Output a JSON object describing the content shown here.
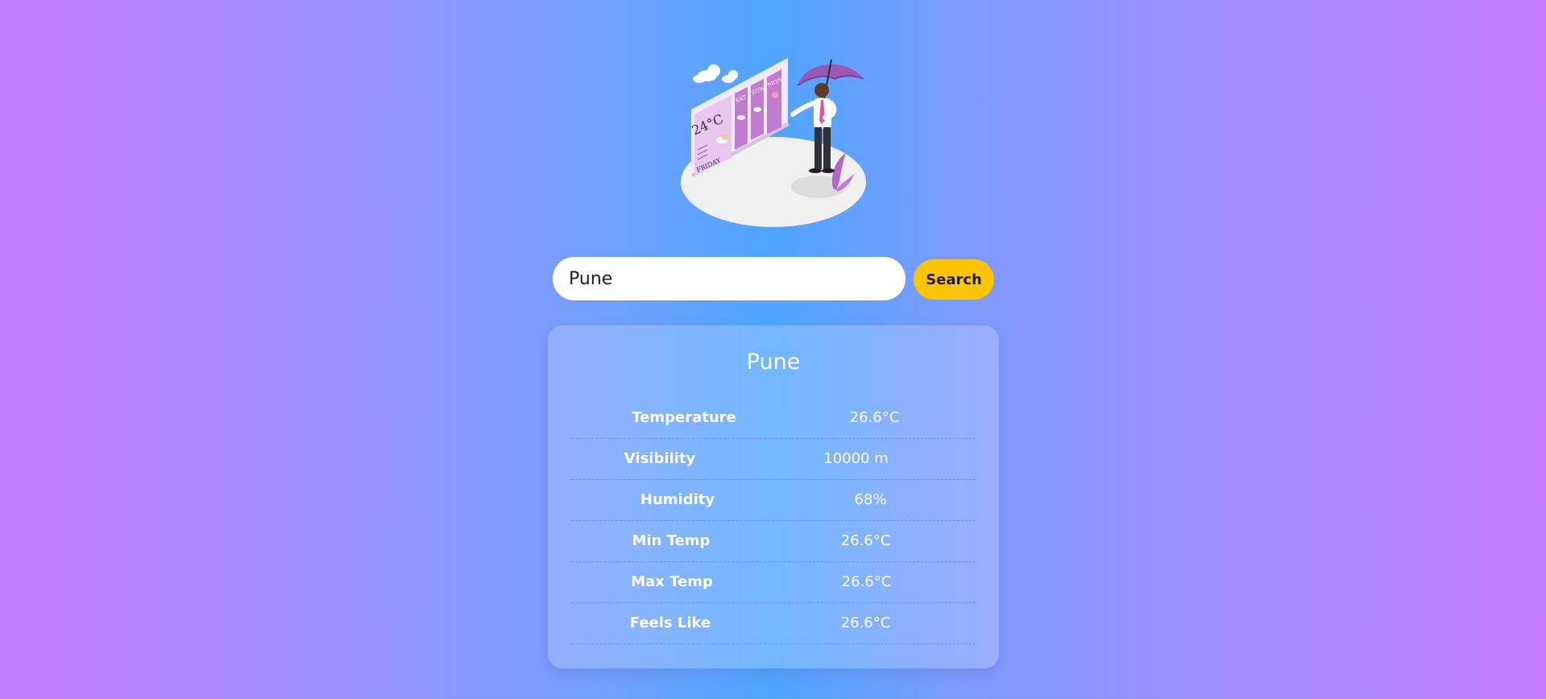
{
  "search": {
    "value": "Pune",
    "button_label": "Search"
  },
  "illustration": {
    "icon": "weather-forecast-person-with-umbrella-icon",
    "board_temp": "24°C",
    "board_day": "FRIDAY",
    "forecast_days": [
      "SAT",
      "SUN",
      "MON"
    ]
  },
  "card": {
    "city": "Pune",
    "rows": [
      {
        "label": "Temperature",
        "value": "26.6°C"
      },
      {
        "label": "Visibility",
        "value": "10000 m"
      },
      {
        "label": "Humidity",
        "value": "68%"
      },
      {
        "label": "Min Temp",
        "value": "26.6°C"
      },
      {
        "label": "Max Temp",
        "value": "26.6°C"
      },
      {
        "label": "Feels Like",
        "value": "26.6°C"
      }
    ]
  },
  "colors": {
    "button": "#ffc400",
    "accent_purple": "#9b59b6"
  }
}
